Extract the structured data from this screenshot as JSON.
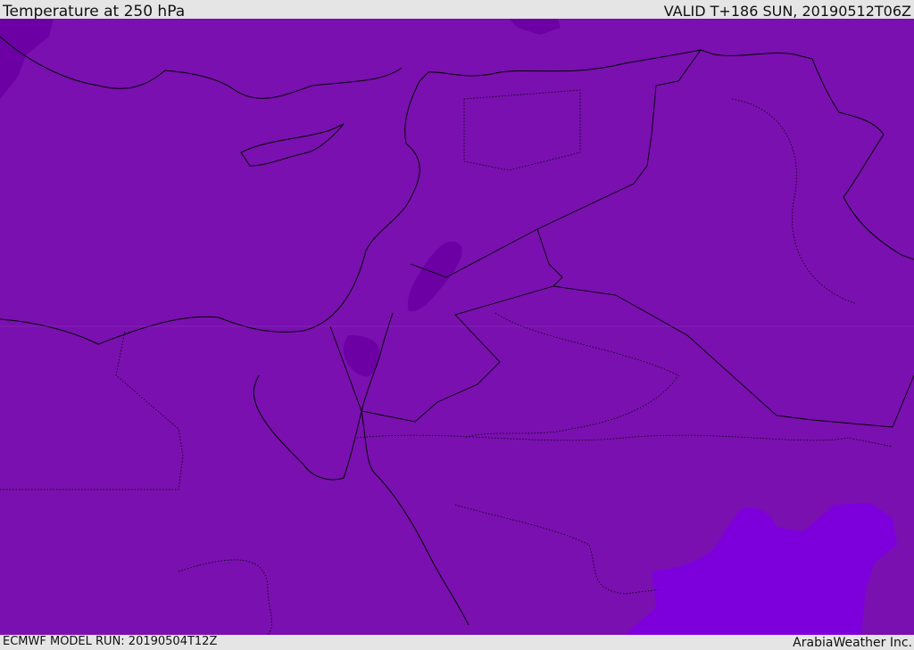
{
  "header": {
    "title": "Temperature at 250 hPa",
    "valid": "VALID T+186 SUN, 20190512T06Z"
  },
  "footer": {
    "model_run": "ECMWF MODEL RUN: 20190504T12Z",
    "credit": "ArabiaWeather Inc."
  },
  "colors": {
    "base": "#7a10b0",
    "cold": "#6a00a0",
    "warm": "#7d00dc",
    "background": "#e5e5e5"
  }
}
